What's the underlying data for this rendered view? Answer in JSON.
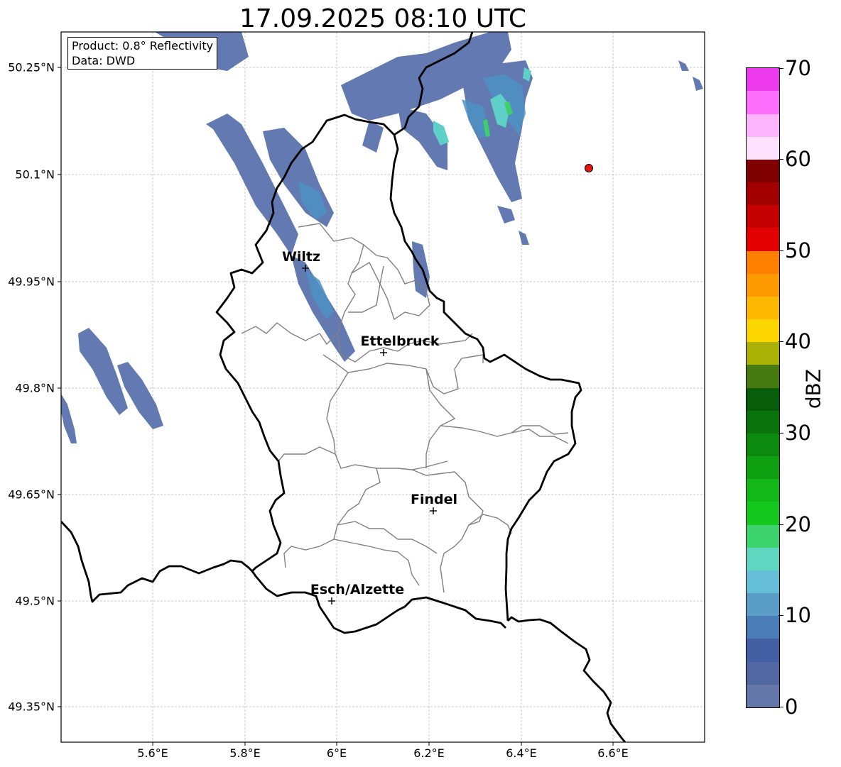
{
  "title": "17.09.2025 08:10 UTC",
  "info": {
    "line1": "Product: 0.8° Reflectivity",
    "line2": "Data: DWD"
  },
  "x_ticks": [
    "5.6°E",
    "5.8°E",
    "6°E",
    "6.2°E",
    "6.4°E",
    "6.6°E"
  ],
  "y_ticks": [
    "50.25°N",
    "50.1°N",
    "49.95°N",
    "49.8°N",
    "49.65°N",
    "49.5°N",
    "49.35°N"
  ],
  "cities": [
    {
      "name": "Wiltz"
    },
    {
      "name": "Ettelbruck"
    },
    {
      "name": "Findel"
    },
    {
      "name": "Esch/Alzette"
    }
  ],
  "colorbar": {
    "label": "dBZ",
    "ticks": [
      "0",
      "10",
      "20",
      "30",
      "40",
      "50",
      "60",
      "70"
    ],
    "colors": [
      "#6577a8",
      "#5168a3",
      "#4460a4",
      "#4a7cb6",
      "#5a9ec8",
      "#65bfd8",
      "#5fd7c0",
      "#3dd36d",
      "#15c81f",
      "#11b818",
      "#0fa012",
      "#0c8a10",
      "#0a730c",
      "#075d09",
      "#487a12",
      "#aab206",
      "#fdd602",
      "#fdb902",
      "#fd9a00",
      "#fd7f00",
      "#e30000",
      "#c40000",
      "#a20000",
      "#7f0000",
      "#fde1fd",
      "#fdb5fd",
      "#fd6efd",
      "#ec39ec"
    ]
  },
  "marker_color": "#e8140f"
}
